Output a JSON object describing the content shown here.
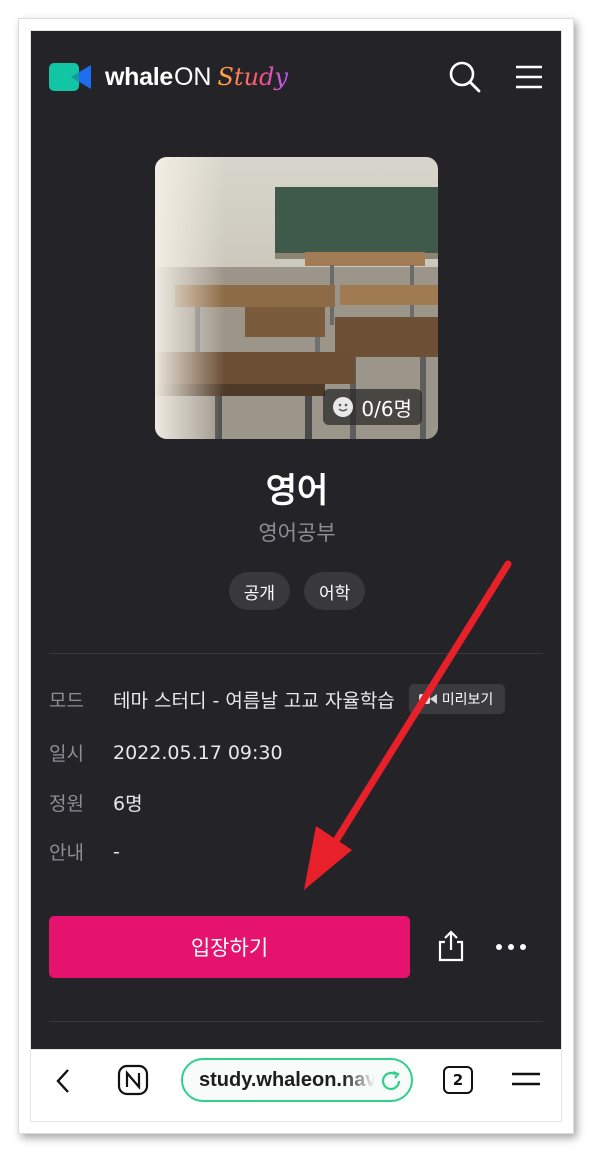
{
  "header": {
    "brand_whale": "whale",
    "brand_on": "ON",
    "brand_study": "Study",
    "icons": [
      "search-icon",
      "hamburger-menu-icon"
    ]
  },
  "study": {
    "participants": "0/6명",
    "title": "영어",
    "subtitle": "영어공부",
    "tags": [
      "공개",
      "어학"
    ]
  },
  "info": {
    "mode_label": "모드",
    "mode_value": "테마 스터디 - 여름날 고교 자율학습",
    "preview_label": "미리보기",
    "datetime_label": "일시",
    "datetime_value": "2022.05.17 09:30",
    "capacity_label": "정원",
    "capacity_value": "6명",
    "notice_label": "안내",
    "notice_value": "-"
  },
  "actions": {
    "enter_label": "입장하기",
    "icons": [
      "share-icon",
      "more-icon"
    ]
  },
  "browser": {
    "url": "study.whaleon.naver.com",
    "tab_count": "2",
    "icons": [
      "back-icon",
      "naver-n-icon",
      "reload-icon",
      "browser-menu-icon"
    ]
  },
  "colors": {
    "background": "#242428",
    "accent": "#e5136e",
    "url_border": "#2fd08a",
    "arrow": "#e8202a"
  }
}
